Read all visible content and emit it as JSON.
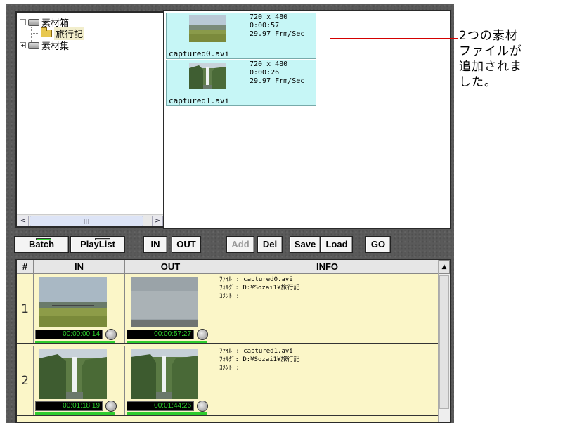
{
  "tree": {
    "root_label": "素材箱",
    "child_label": "旅行記",
    "second_label": "素材集",
    "collapse_glyph": "−",
    "expand_glyph": "+",
    "scroll_left": "<",
    "scroll_right": ">",
    "scroll_grip": "|||"
  },
  "bin": {
    "clips": [
      {
        "resolution": "720 x 480",
        "duration": "0:00:57",
        "fps": "29.97 Frm/Sec",
        "filename": "captured0.avi",
        "thumb": "field-landscape"
      },
      {
        "resolution": "720 x 480",
        "duration": "0:00:26",
        "fps": "29.97 Frm/Sec",
        "filename": "captured1.avi",
        "thumb": "waterfall"
      }
    ]
  },
  "toolbar": {
    "batch": "Batch",
    "playlist": "PlayList",
    "in": "IN",
    "out": "OUT",
    "add": "Add",
    "del": "Del",
    "save": "Save",
    "load": "Load",
    "go": "GO"
  },
  "list": {
    "headers": {
      "num": "#",
      "in": "IN",
      "out": "OUT",
      "info": "INFO"
    },
    "scroll_up": "▲",
    "rows": [
      {
        "num": "1",
        "in_tc": "00:00:00:14",
        "out_tc": "00:00:57:27",
        "info_file": "ﾌｧｲﾙ : captured0.avi",
        "info_folder": "ﾌｫﾙﾀﾞ: D:¥Sozai1¥旅行記",
        "info_comment": "ｺﾒﾝﾄ :"
      },
      {
        "num": "2",
        "in_tc": "00:01:18:19",
        "out_tc": "00:01:44:26",
        "info_file": "ﾌｧｲﾙ : captured1.avi",
        "info_folder": "ﾌｫﾙﾀﾞ: D:¥Sozai1¥旅行記",
        "info_comment": "ｺﾒﾝﾄ :"
      }
    ]
  },
  "annotation": {
    "text": "2つの素材\nファイルが\n追加されま\nした。",
    "line_color": "#d40000"
  },
  "colors": {
    "clip_bg": "#c6f6f6",
    "list_bg": "#fbf6c8",
    "timecode_text": "#2dd02d",
    "progress_bar": "#2ecc2e",
    "led_batch": "#35d635"
  }
}
